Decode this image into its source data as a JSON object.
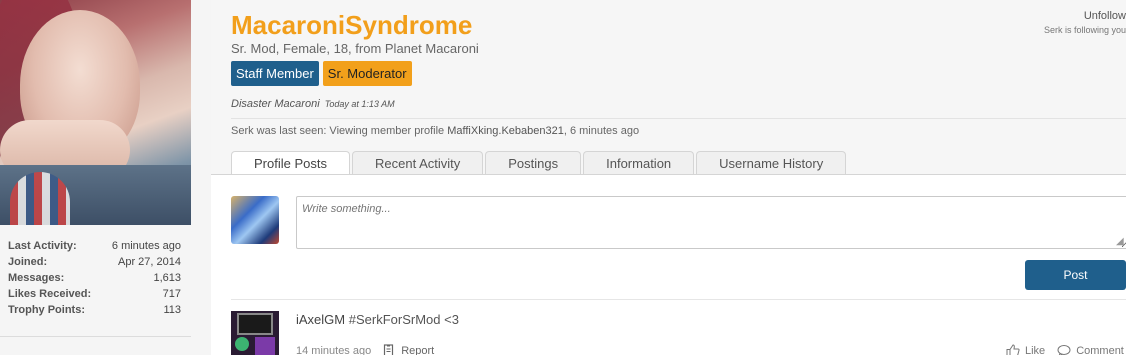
{
  "profile": {
    "username": "MacaroniSyndrome",
    "info": "Sr. Mod, Female, 18, from Planet Macaroni",
    "banners": [
      "Staff Member",
      "Sr. Moderator"
    ],
    "status_message": "Disaster Macaroni",
    "status_time": "Today at 1:13 AM",
    "last_seen_prefix": "Serk was last seen: Viewing member profile",
    "last_seen_member": "MaffiXking.Kebaben321",
    "last_seen_time": ", 6 minutes ago"
  },
  "follow": {
    "unfollow_label": "Unfollow",
    "following_text": "Serk is following you"
  },
  "stats": [
    {
      "label": "Last Activity:",
      "value": "6 minutes ago"
    },
    {
      "label": "Joined:",
      "value": "Apr 27, 2014"
    },
    {
      "label": "Messages:",
      "value": "1,613"
    },
    {
      "label": "Likes Received:",
      "value": "717"
    },
    {
      "label": "Trophy Points:",
      "value": "113"
    }
  ],
  "tabs": [
    "Profile Posts",
    "Recent Activity",
    "Postings",
    "Information",
    "Username History"
  ],
  "composer": {
    "placeholder": "Write something...",
    "post_label": "Post"
  },
  "comment": {
    "author": "iAxelGM",
    "text": "#SerkForSrMod <3",
    "time": "14 minutes ago",
    "report_label": "Report",
    "like_label": "Like",
    "comment_label": "Comment"
  },
  "colors": {
    "username": "#f29f1b",
    "staff_banner": "#1f5f8c",
    "mod_banner": "#f2a01b",
    "post_button": "#1f5f8c"
  }
}
